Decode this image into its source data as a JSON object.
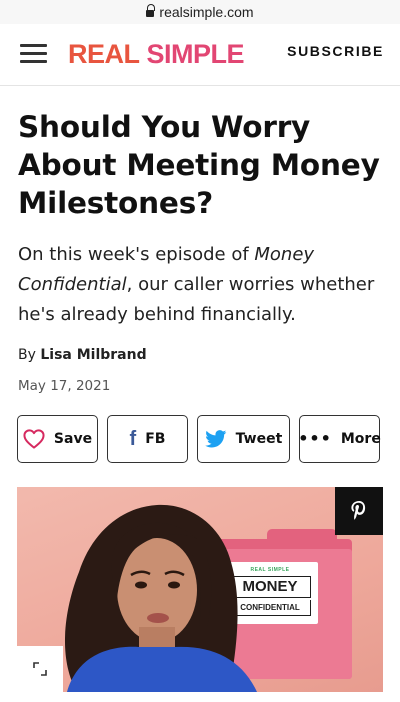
{
  "browser": {
    "url": "realsimple.com"
  },
  "header": {
    "logo_word1": "REAL",
    "logo_word2": "SIMPLE",
    "subscribe_label": "SUBSCRIBE"
  },
  "article": {
    "title": "Should You Worry About Meeting Money Milestones?",
    "dek_prefix": "On this week's episode of ",
    "dek_italic": "Money Confidential",
    "dek_suffix": ", our caller worries whether he's already behind financially.",
    "byline_prefix": "By ",
    "author": "Lisa Milbrand",
    "date": "May 17, 2021"
  },
  "share": {
    "save_label": "Save",
    "fb_label": "FB",
    "tweet_label": "Tweet",
    "more_label": "More"
  },
  "hero": {
    "card_brand": "REAL SIMPLE",
    "card_title": "MONEY",
    "card_subtitle": "CONFIDENTIAL"
  },
  "icons": {
    "save": "heart-icon",
    "fb": "facebook-icon",
    "tweet": "twitter-bird-icon",
    "more": "ellipsis-icon",
    "pin": "pinterest-icon",
    "expand": "expand-icon",
    "menu": "hamburger-icon",
    "lock": "lock-icon"
  },
  "colors": {
    "logo_real": "#e8553f",
    "logo_simple": "#e24673",
    "heart": "#d6295f",
    "facebook": "#3b5998",
    "twitter": "#1da1f2",
    "hero_background": "#efb0a5",
    "folder": "#ec7a93"
  }
}
